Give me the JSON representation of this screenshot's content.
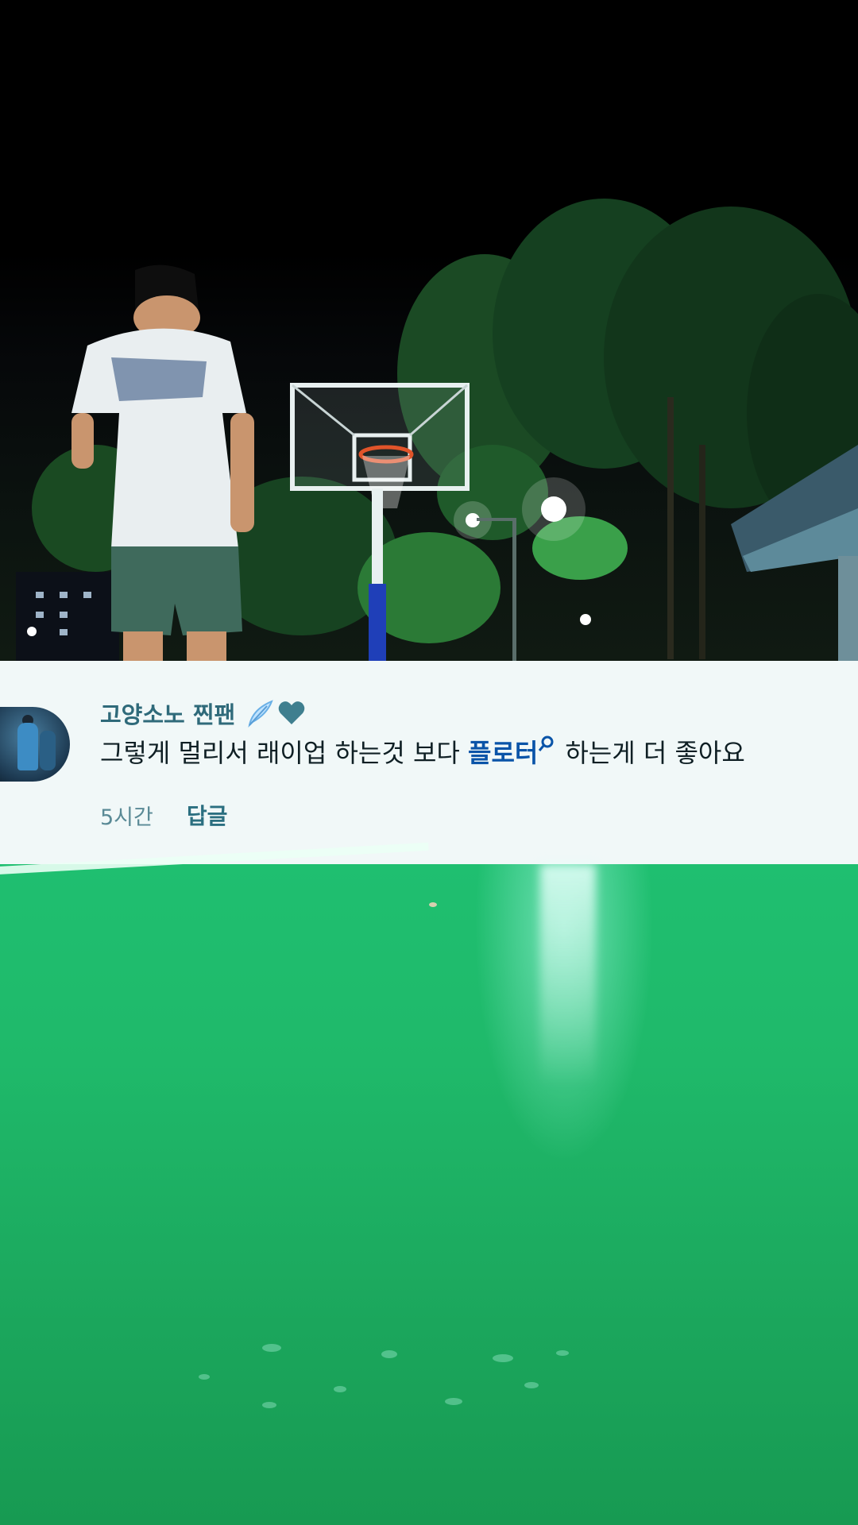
{
  "comment": {
    "username": "고양소노 찐팬",
    "username_badges": [
      "feather-icon",
      "teal-heart-icon"
    ],
    "text_before_link": "그렇게 멀리서 래이업 하는것 보다 ",
    "link_text": "플로터",
    "text_after_link": "하는게 더 좋아요",
    "timestamp": "5시간",
    "reply_label": "답글"
  },
  "colors": {
    "card_background": "#f1f8f8",
    "username": "#2f6a7a",
    "link": "#0a54a8",
    "meta": "#5a8a96",
    "court_green": "#1fb96a"
  }
}
